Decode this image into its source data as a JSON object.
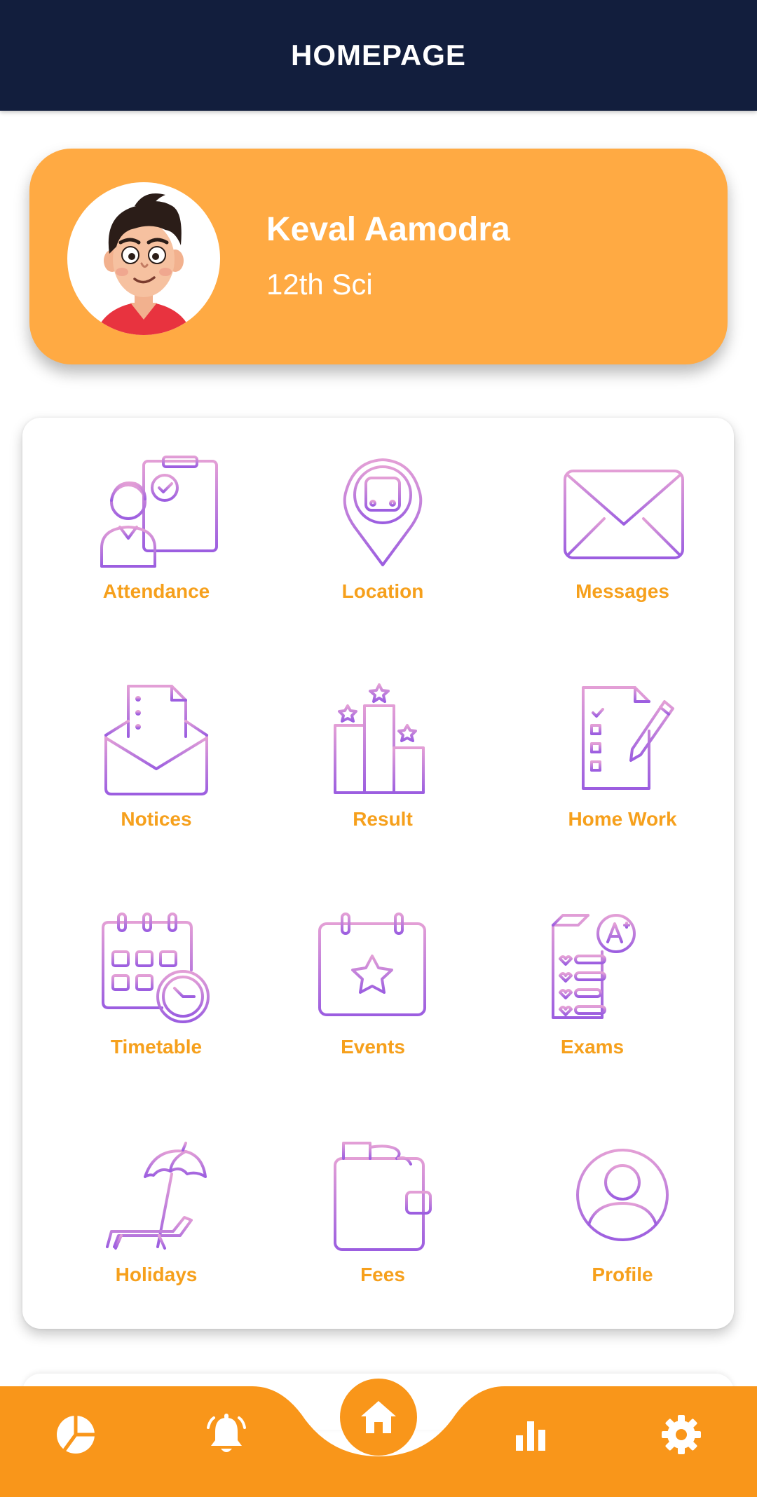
{
  "header": {
    "title": "HOMEPAGE"
  },
  "profile": {
    "name": "Keval Aamodra",
    "class": "12th Sci",
    "card_color": "#ffaa43"
  },
  "menu": {
    "items": [
      {
        "label": "Attendance",
        "icon": "attendance-icon"
      },
      {
        "label": "Location",
        "icon": "bus-location-icon"
      },
      {
        "label": "Messages",
        "icon": "envelope-icon"
      },
      {
        "label": "Notices",
        "icon": "notice-letter-icon"
      },
      {
        "label": "Result",
        "icon": "result-podium-icon"
      },
      {
        "label": "Home Work",
        "icon": "homework-checklist-icon"
      },
      {
        "label": "Timetable",
        "icon": "calendar-clock-icon"
      },
      {
        "label": "Events",
        "icon": "calendar-star-icon"
      },
      {
        "label": "Exams",
        "icon": "exam-grade-icon"
      },
      {
        "label": "Holidays",
        "icon": "beach-umbrella-icon"
      },
      {
        "label": "Fees",
        "icon": "wallet-icon"
      },
      {
        "label": "Profile",
        "icon": "user-profile-icon"
      }
    ],
    "label_color": "#f6a01c",
    "icon_gradient": [
      "#e39fd6",
      "#9c5ee0"
    ]
  },
  "bottom_nav": {
    "items": [
      {
        "icon": "pie-chart-icon"
      },
      {
        "icon": "bell-icon"
      },
      {
        "icon": "home-icon"
      },
      {
        "icon": "bar-chart-icon"
      },
      {
        "icon": "gear-icon"
      }
    ],
    "color": "#f9961a"
  },
  "colors": {
    "header_bg": "#121e3d",
    "accent": "#f9961a"
  }
}
